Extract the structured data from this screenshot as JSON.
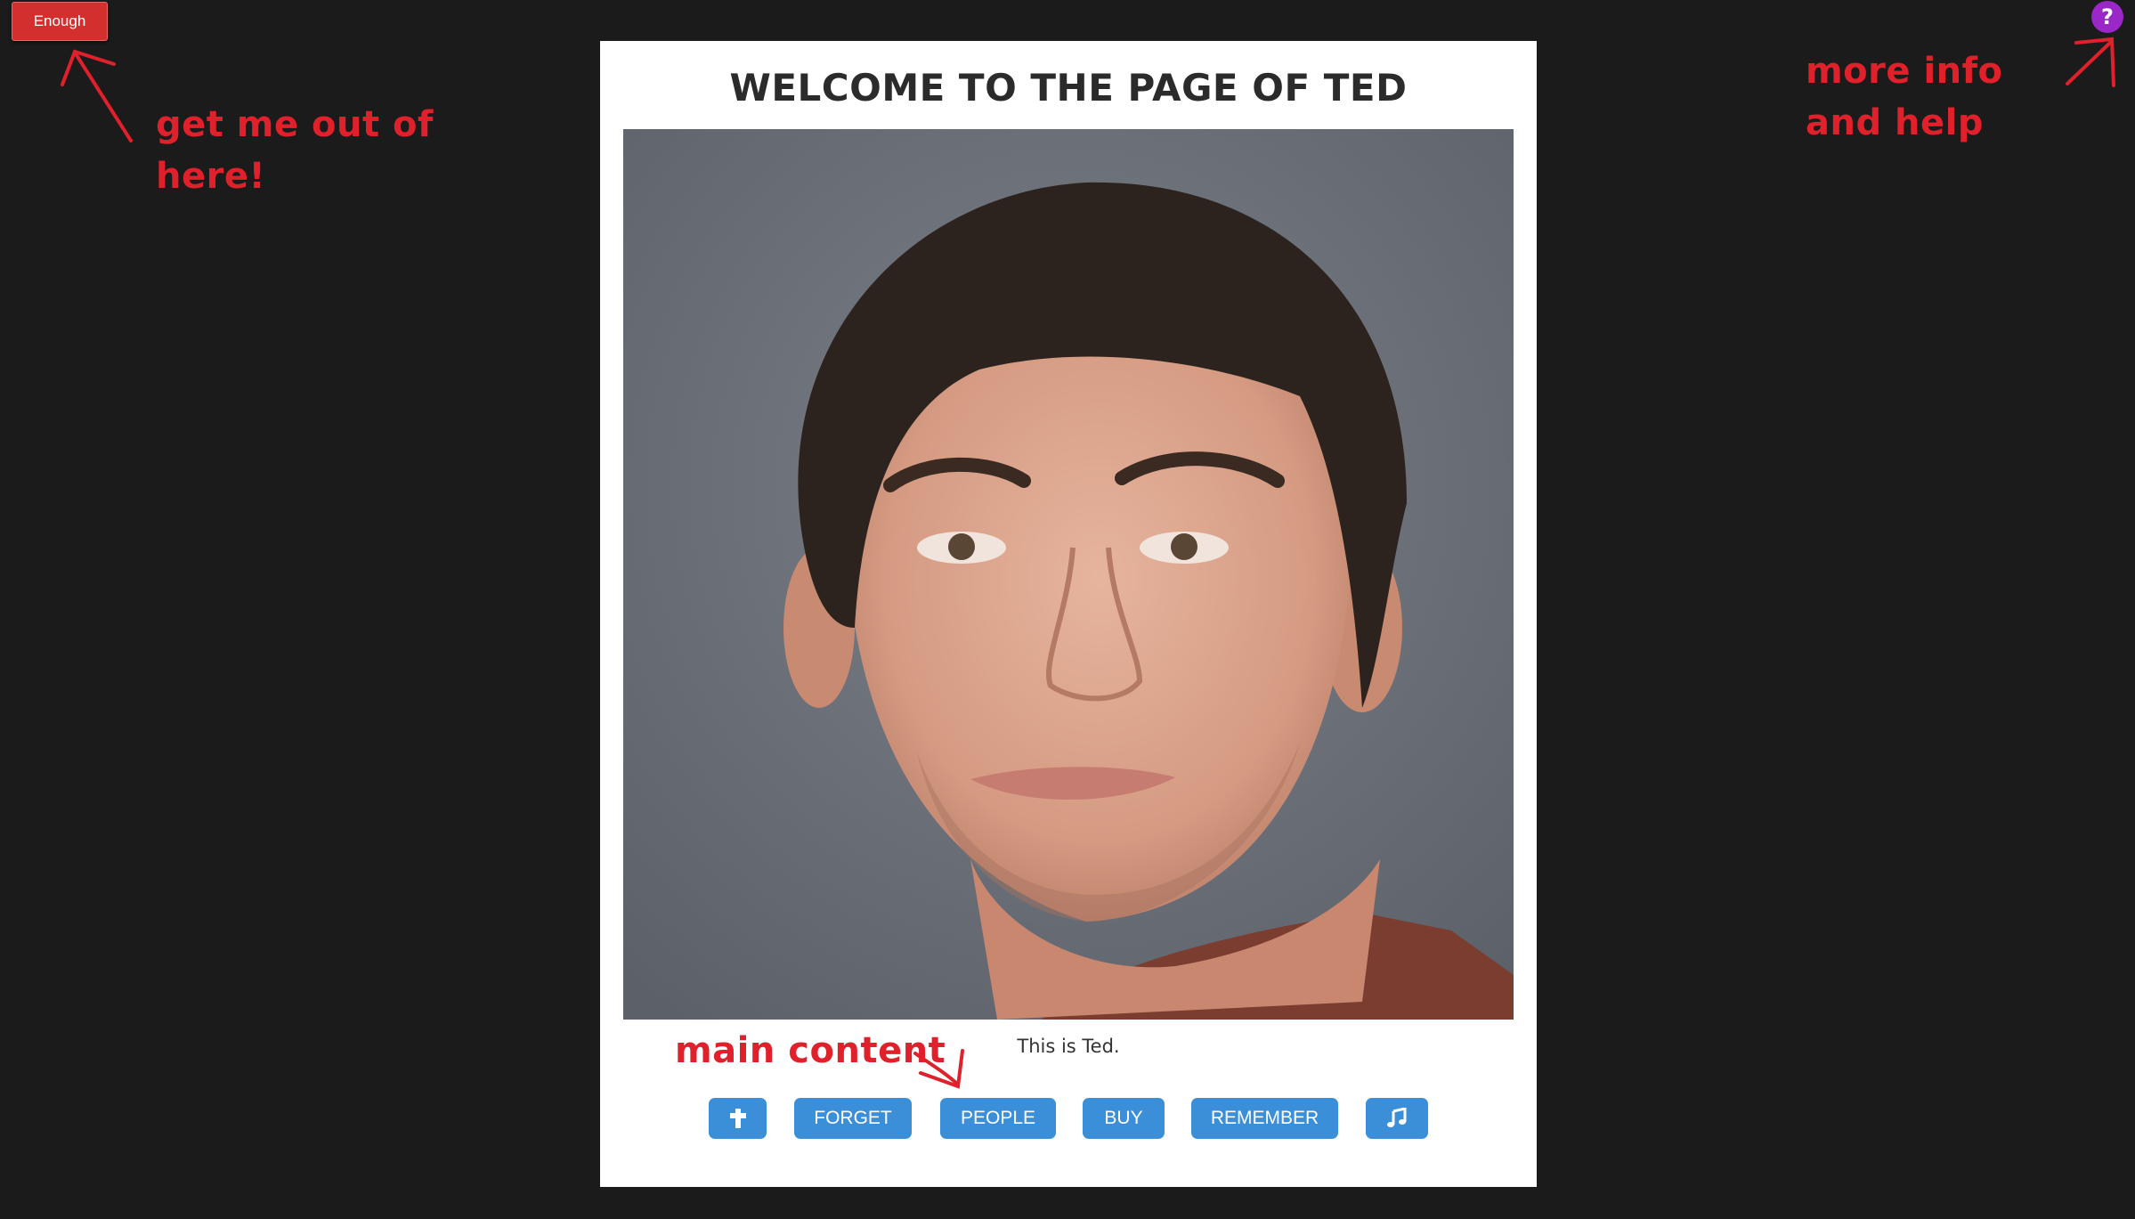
{
  "top_left": {
    "button_label": "Enough",
    "annotation": "get me out of here!"
  },
  "top_right": {
    "help_label": "?",
    "annotation": "more info and help"
  },
  "main": {
    "title": "WELCOME TO THE PAGE OF TED",
    "photo_subject": "portrait of Ted, smiling man with dark hair on grey background",
    "caption": "This is Ted.",
    "annotation": "main content",
    "buttons": [
      {
        "icon": "cross-icon"
      },
      {
        "label": "FORGET"
      },
      {
        "label": "PEOPLE"
      },
      {
        "label": "BUY"
      },
      {
        "label": "REMEMBER"
      },
      {
        "icon": "music-note-icon"
      }
    ]
  },
  "colors": {
    "background": "#1b1b1c",
    "panel": "#ffffff",
    "exit_button": "#d42f2f",
    "help_button": "#9b27c9",
    "nav_button": "#3b8fd8",
    "annotation": "#e0202a"
  }
}
